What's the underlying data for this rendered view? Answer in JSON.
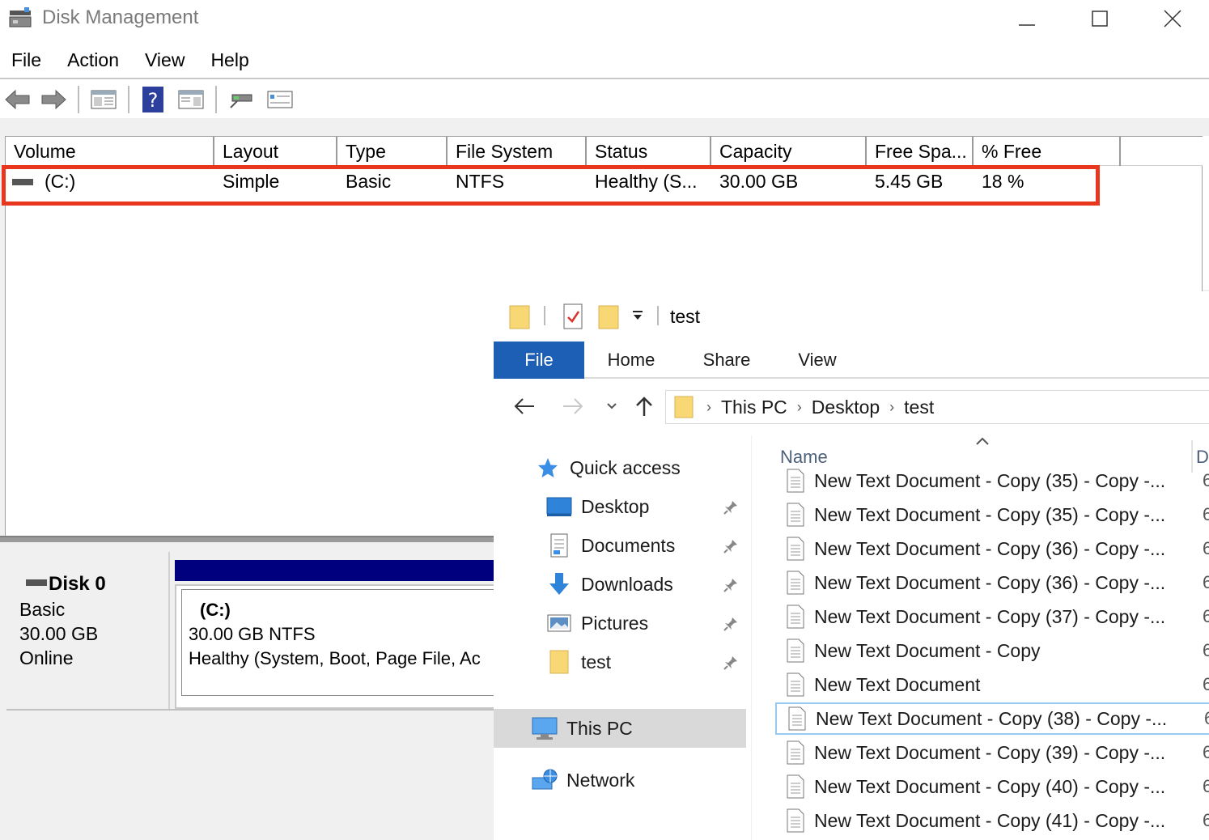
{
  "disk_mgmt": {
    "title": "Disk Management",
    "menu": [
      "File",
      "Action",
      "View",
      "Help"
    ],
    "columns": [
      "Volume",
      "Layout",
      "Type",
      "File System",
      "Status",
      "Capacity",
      "Free Spa...",
      "% Free"
    ],
    "volume_row": {
      "volume": "(C:)",
      "layout": "Simple",
      "type": "Basic",
      "file_system": "NTFS",
      "status": "Healthy (S...",
      "capacity": "30.00 GB",
      "free_space": "5.45 GB",
      "percent_free": "18 %"
    },
    "disk": {
      "name": "Disk 0",
      "type": "Basic",
      "size": "30.00 GB",
      "status": "Online"
    },
    "partition": {
      "name": "(C:)",
      "size": "30.00 GB NTFS",
      "health": "Healthy (System, Boot, Page File, Ac"
    },
    "colors": {
      "highlight": "#e8371e",
      "partition_bar": "#00007f"
    }
  },
  "explorer": {
    "title": "test",
    "tabs": [
      "File",
      "Home",
      "Share",
      "View"
    ],
    "breadcrumb": [
      "This PC",
      "Desktop",
      "test"
    ],
    "nav": {
      "quick_access": "Quick access",
      "items": [
        "Desktop",
        "Documents",
        "Downloads",
        "Pictures",
        "test"
      ],
      "this_pc": "This PC",
      "network": "Network"
    },
    "column_name": "Name",
    "column_next": "D",
    "files": [
      "New Text Document - Copy (35) - Copy -...",
      "New Text Document - Copy (35) - Copy -...",
      "New Text Document - Copy (36) - Copy -...",
      "New Text Document - Copy (36) - Copy -...",
      "New Text Document - Copy (37) - Copy -...",
      "New Text Document - Copy",
      "New Text Document",
      "New Text Document - Copy (38) - Copy -...",
      "New Text Document - Copy (39) - Copy -...",
      "New Text Document - Copy (40) - Copy -...",
      "New Text Document - Copy (41) - Copy -..."
    ],
    "file_date_prefix": "6",
    "colors": {
      "file_tab": "#1d5fb4",
      "selected_border": "#99c9ef"
    }
  }
}
